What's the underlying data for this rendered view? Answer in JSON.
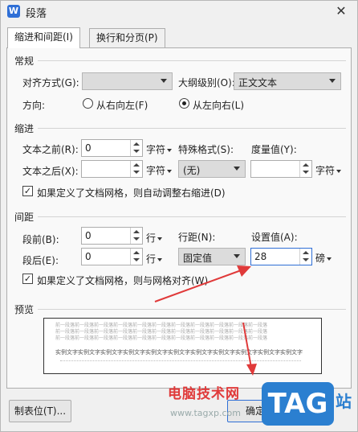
{
  "window": {
    "title": "段落",
    "app_icon": "W"
  },
  "tabs": [
    {
      "label": "缩进和间距(I)",
      "active": true
    },
    {
      "label": "换行和分页(P)",
      "active": false
    }
  ],
  "general": {
    "heading": "常规",
    "alignment_label": "对齐方式(G):",
    "alignment_value": "",
    "outline_label": "大纲级别(O):",
    "outline_value": "正文文本",
    "direction_label": "方向:",
    "rtl_label": "从右向左(F)",
    "ltr_label": "从左向右(L)",
    "direction_selected": "ltr"
  },
  "indent": {
    "heading": "缩进",
    "before_label": "文本之前(R):",
    "before_value": "0",
    "before_unit": "字符",
    "after_label": "文本之后(X):",
    "after_value": "",
    "after_unit": "字符",
    "special_label": "特殊格式(S):",
    "special_value": "(无)",
    "measure_label": "度量值(Y):",
    "measure_value": "",
    "measure_unit": "字符",
    "grid_check_label": "如果定义了文档网格，则自动调整右缩进(D)",
    "grid_check_checked": true,
    "check_mark": "✓"
  },
  "spacing": {
    "heading": "间距",
    "before_label": "段前(B):",
    "before_value": "0",
    "before_unit": "行",
    "after_label": "段后(E):",
    "after_value": "0",
    "after_unit": "行",
    "line_label": "行距(N):",
    "line_value": "固定值",
    "setting_label": "设置值(A):",
    "setting_value": "28",
    "setting_unit": "磅",
    "grid_check_label": "如果定义了文档网格，则与网格对齐(W)",
    "grid_check_checked": true,
    "check_mark": "✓"
  },
  "preview": {
    "heading": "预览",
    "prev_para": "前一段落前一段落前一段落前一段落前一段落前一段落前一段落前一段落前一段落前一段落前一段落",
    "sample_text": "实例文字实例文字实例文字实例文字实例文字实例文字实例文字实例文字实例文字实例文字实例文字"
  },
  "footer": {
    "tabs_button": "制表位(T)...",
    "ok_button": "确定"
  },
  "watermark": {
    "brand": "电脑技术网",
    "url": "www.tagxp.com",
    "tag": "TAG",
    "suffix": "站"
  },
  "colors": {
    "accent": "#2f6fd6",
    "arrow": "#e03a3a"
  }
}
